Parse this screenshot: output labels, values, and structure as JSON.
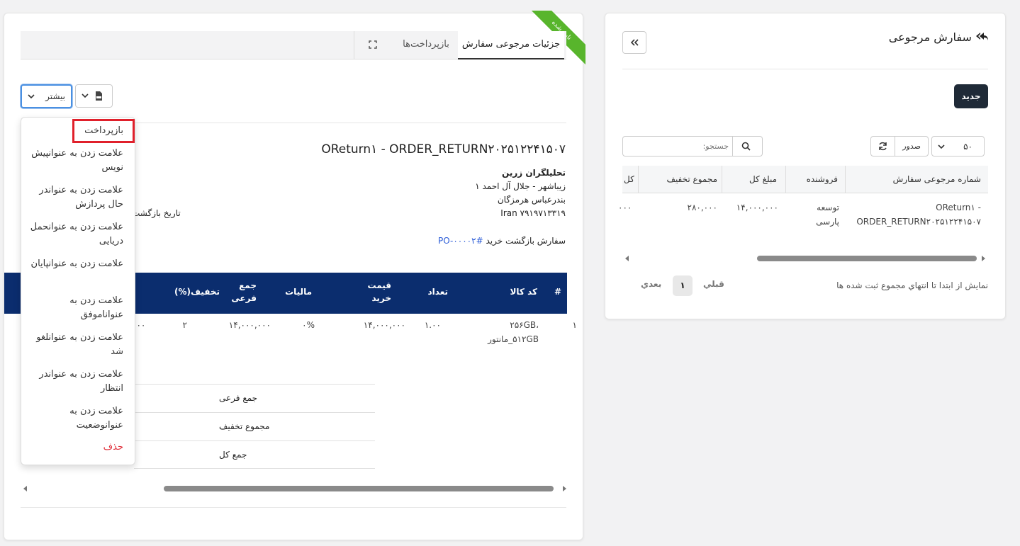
{
  "left": {
    "ribbon": "تایید شده",
    "tabs": {
      "details": "جزئیات مرجوعی سفارش",
      "refunds": "بازپرداخت‌ها"
    },
    "more_button": "بیشتر",
    "dropdown": [
      {
        "label": "بازپرداخت",
        "highlight": true
      },
      {
        "label": "علامت زدن به عنوانپیش نویس"
      },
      {
        "label": "علامت زدن به عنواندر حال پردازش"
      },
      {
        "label": "علامت زدن به عنوانحمل دریایی"
      },
      {
        "label": "علامت زدن به عنوانپایان"
      },
      {
        "label": "علامت زدن به عنواناموفق"
      },
      {
        "label": "علامت زدن به عنوانلغو شد"
      },
      {
        "label": "علامت زدن به عنواندر انتظار"
      },
      {
        "label": "علامت زدن به عنوانوضعیت"
      },
      {
        "label": "حذف",
        "danger": true
      }
    ],
    "doc_title": "OReturn۱ - ORDER_RETURN۲۰۲۵۱۲۲۴۱۵۰۷",
    "company": "تحلیلگران زرین",
    "address1": "زیباشهر - جلال آل احمد ۱",
    "address2": "بندرعباس هرمزگان",
    "address3": "Iran ۷۹۱۹۷۱۳۳۱۹",
    "return_date_label": "تاریخ بازگشت",
    "po_label": "سفارش بازگشت خرید",
    "po_value": "#PO-۰۰۰۰۲",
    "table": {
      "headers": {
        "num": "#",
        "code": "کد کالا",
        "qty": "تعداد",
        "price": "قیمت خرید",
        "tax": "مالیات",
        "subtotal": "جمع فرعی",
        "discount": "تخفیف(%)",
        "extra": "تخ"
      },
      "row": {
        "num": "۱",
        "code": "۲۵۶GB، ۵۱۲GB_مانتور",
        "qty": "۱.۰۰",
        "price": "۱۴,۰۰۰,۰۰۰",
        "tax": "۰%",
        "subtotal": "۱۴,۰۰۰,۰۰۰",
        "discount": "۲",
        "extra": "۰۰۰"
      }
    },
    "summary": {
      "subtotal": "جمع فرعی",
      "discount": "مجموع تخفیف",
      "total": "جمع کل"
    }
  },
  "right": {
    "title": "سفارش مرجوعی",
    "new_button": "جدید",
    "page_size": "۵۰",
    "export": "صدور",
    "search_placeholder": "جستجو:",
    "headers": {
      "number": "شماره مرجوعی سفارش",
      "seller": "فروشنده",
      "total": "مبلغ کل",
      "discount": "مجموع تخفیف",
      "extra": "کل"
    },
    "row": {
      "number": "OReturn۱ - ORDER_RETURN۲۰۲۵۱۲۲۴۱۵۰۷",
      "seller": "توسعه پارسی",
      "total": "۱۴,۰۰۰,۰۰۰",
      "discount": "۲۸۰,۰۰۰",
      "extra": "۰۰۰"
    },
    "info": "نمایش از ابتدا تا انتهاي مجموع ثبت شده ها",
    "prev": "قبلي",
    "page": "۱",
    "next": "بعدي"
  }
}
